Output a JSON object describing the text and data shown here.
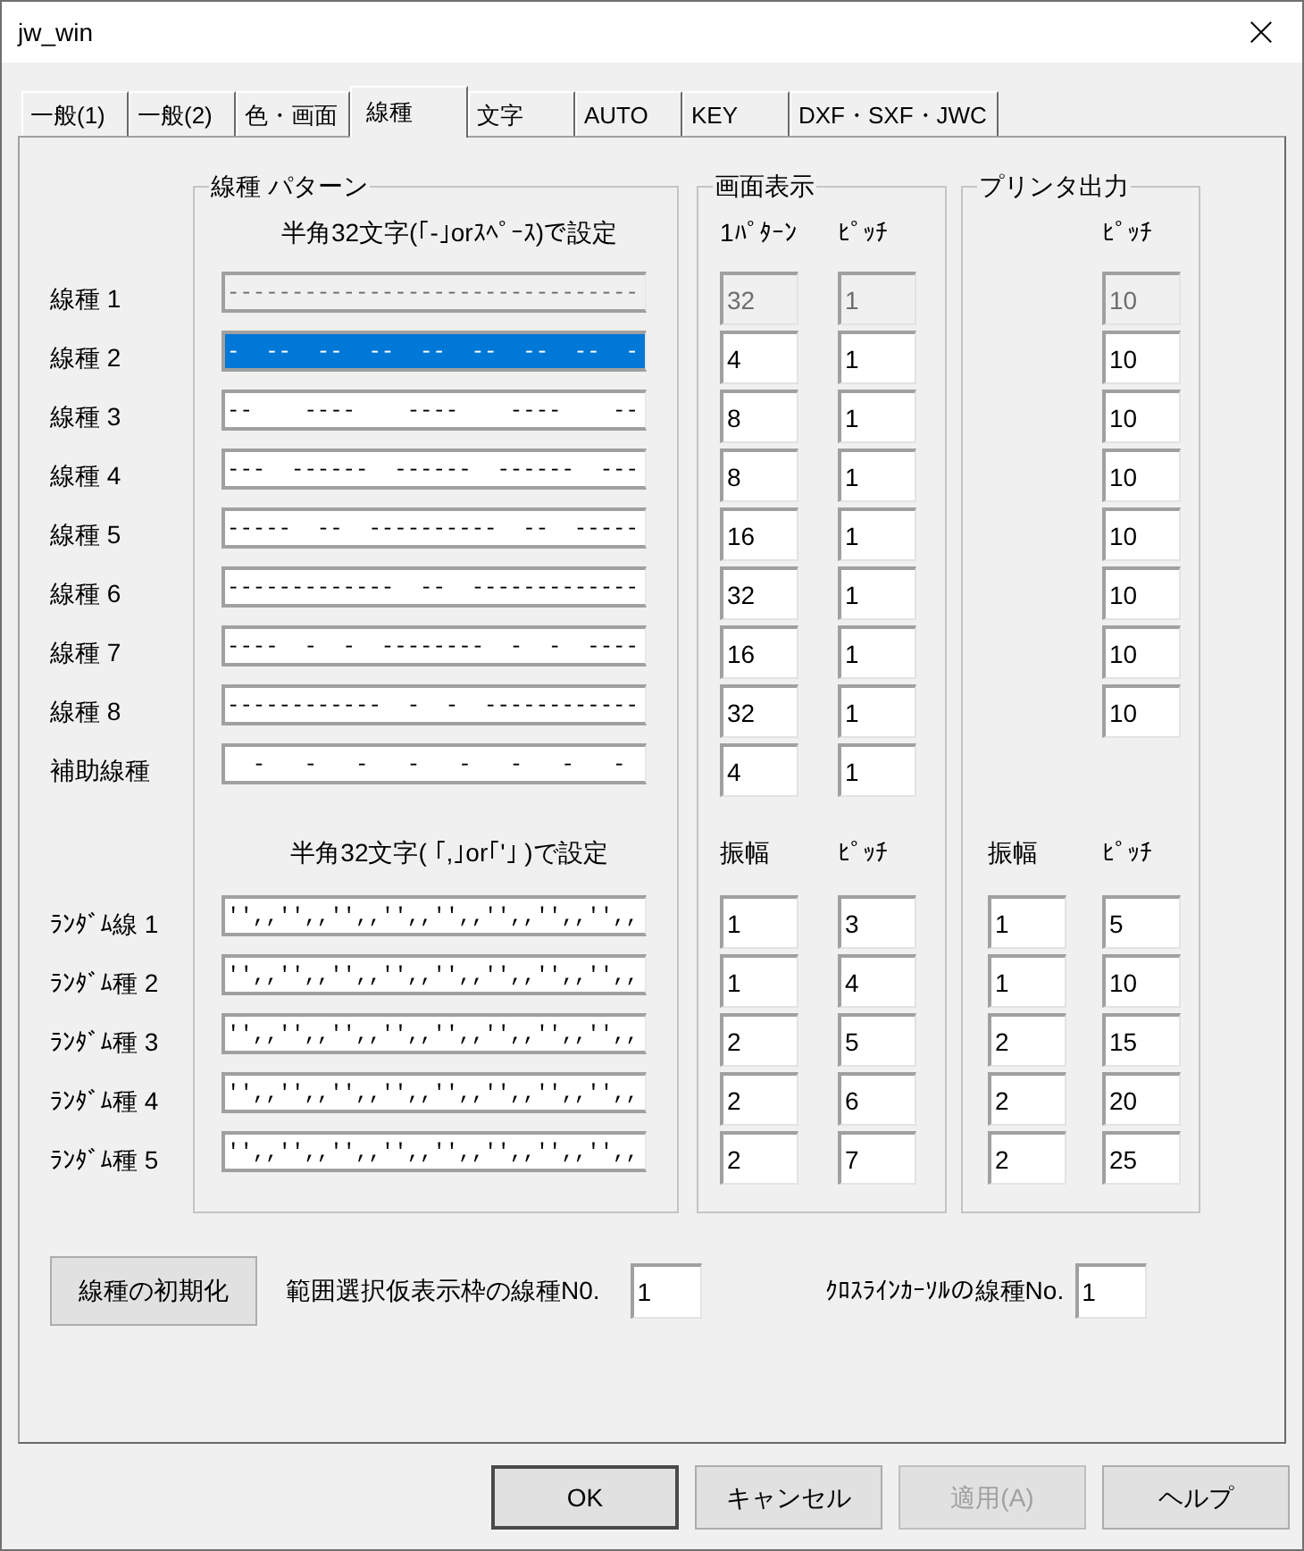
{
  "window": {
    "title": "jw_win"
  },
  "tabs": [
    {
      "label": "一般(1)",
      "selected": false
    },
    {
      "label": "一般(2)",
      "selected": false
    },
    {
      "label": "色・画面",
      "selected": false
    },
    {
      "label": "線種",
      "selected": true
    },
    {
      "label": "文字",
      "selected": false
    },
    {
      "label": "AUTO",
      "selected": false
    },
    {
      "label": "KEY",
      "selected": false
    },
    {
      "label": "DXF・SXF・JWC",
      "selected": false
    }
  ],
  "line_pattern_group": {
    "title": "線種 パターン",
    "hint": "半角32文字(｢-｣orｽﾍﾟｰｽ)で設定",
    "random_hint": "半角32文字( ｢,｣or｢'｣ )で設定"
  },
  "screen_group": {
    "title": "画面表示",
    "headers": [
      "1ﾊﾟﾀｰﾝ",
      "ﾋﾟｯﾁ"
    ],
    "random_headers": [
      "振幅",
      "ﾋﾟｯﾁ"
    ]
  },
  "printer_group": {
    "title": "プリンタ出力",
    "headers": [
      "ﾋﾟｯﾁ"
    ],
    "random_headers": [
      "振幅",
      "ﾋﾟｯﾁ"
    ]
  },
  "line_types": [
    {
      "label": "線種 1",
      "pattern": "--------------------------------",
      "selected": false,
      "disabled": true,
      "screen_pattern": "32",
      "screen_pitch": "1",
      "printer_pitch": "10"
    },
    {
      "label": "線種 2",
      "pattern": "-  --  --  --  --  --  --  --  -",
      "selected": true,
      "disabled": false,
      "screen_pattern": "4",
      "screen_pitch": "1",
      "printer_pitch": "10"
    },
    {
      "label": "線種 3",
      "pattern": "--    ----    ----    ----    --",
      "selected": false,
      "disabled": false,
      "screen_pattern": "8",
      "screen_pitch": "1",
      "printer_pitch": "10"
    },
    {
      "label": "線種 4",
      "pattern": "---  ------  ------  ------  ---",
      "selected": false,
      "disabled": false,
      "screen_pattern": "8",
      "screen_pitch": "1",
      "printer_pitch": "10"
    },
    {
      "label": "線種 5",
      "pattern": "-----  --  ----------  --  -----",
      "selected": false,
      "disabled": false,
      "screen_pattern": "16",
      "screen_pitch": "1",
      "printer_pitch": "10"
    },
    {
      "label": "線種 6",
      "pattern": "-------------  --  -------------",
      "selected": false,
      "disabled": false,
      "screen_pattern": "32",
      "screen_pitch": "1",
      "printer_pitch": "10"
    },
    {
      "label": "線種 7",
      "pattern": "----  -  -  --------  -  -  ----",
      "selected": false,
      "disabled": false,
      "screen_pattern": "16",
      "screen_pitch": "1",
      "printer_pitch": "10"
    },
    {
      "label": "線種 8",
      "pattern": "------------  -  -  ------------",
      "selected": false,
      "disabled": false,
      "screen_pattern": "32",
      "screen_pitch": "1",
      "printer_pitch": "10"
    },
    {
      "label": "補助線種",
      "pattern": "  -   -   -   -   -   -   -   -",
      "selected": false,
      "disabled": false,
      "screen_pattern": "4",
      "screen_pitch": "1"
    }
  ],
  "random_lines": [
    {
      "label": "ﾗﾝﾀﾞﾑ線 1",
      "pattern": "'',,'',,'',,'',,'',,'',,'',,'',,",
      "screen_amplitude": "1",
      "screen_pitch": "3",
      "printer_amplitude": "1",
      "printer_pitch": "5"
    },
    {
      "label": "ﾗﾝﾀﾞﾑ種 2",
      "pattern": "'',,'',,'',,'',,'',,'',,'',,'',,",
      "screen_amplitude": "1",
      "screen_pitch": "4",
      "printer_amplitude": "1",
      "printer_pitch": "10"
    },
    {
      "label": "ﾗﾝﾀﾞﾑ種 3",
      "pattern": "'',,'',,'',,'',,'',,'',,'',,'',,",
      "screen_amplitude": "2",
      "screen_pitch": "5",
      "printer_amplitude": "2",
      "printer_pitch": "15"
    },
    {
      "label": "ﾗﾝﾀﾞﾑ種 4",
      "pattern": "'',,'',,'',,'',,'',,'',,'',,'',,",
      "screen_amplitude": "2",
      "screen_pitch": "6",
      "printer_amplitude": "2",
      "printer_pitch": "20"
    },
    {
      "label": "ﾗﾝﾀﾞﾑ種 5",
      "pattern": "'',,'',,'',,'',,'',,'',,'',,'',,",
      "screen_amplitude": "2",
      "screen_pitch": "7",
      "printer_amplitude": "2",
      "printer_pitch": "25"
    }
  ],
  "reset_button": "線種の初期化",
  "range_select": {
    "label": "範囲選択仮表示枠の線種N0.",
    "value": "1"
  },
  "crossline_cursor": {
    "label": "ｸﾛｽﾗｲﾝｶｰｿﾙの線種No.",
    "value": "1"
  },
  "buttons": [
    {
      "label": "OK",
      "default": true,
      "disabled": false
    },
    {
      "label": "キャンセル",
      "default": false,
      "disabled": false
    },
    {
      "label": "適用(A)",
      "default": false,
      "disabled": true
    },
    {
      "label": "ヘルプ",
      "default": false,
      "disabled": false
    }
  ]
}
